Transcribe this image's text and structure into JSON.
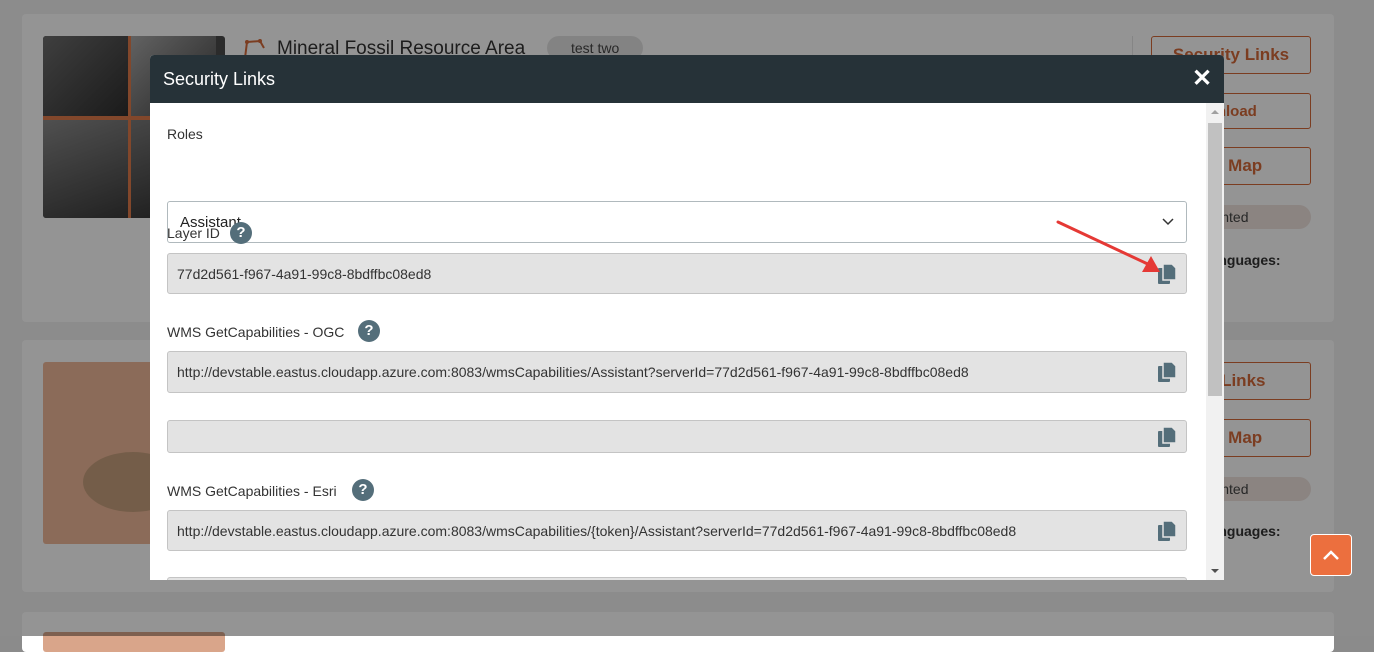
{
  "background": {
    "card1": {
      "title": "Mineral Fossil Resource Area",
      "tag": "test two",
      "buttons": [
        "Security Links",
        "wnload",
        "On Map"
      ],
      "status": "ented",
      "languages_label": "Languages:"
    },
    "card2": {
      "buttons": [
        "ity Links",
        "On Map"
      ],
      "status": "ented",
      "languages_label": "Languages:"
    }
  },
  "modal": {
    "title": "Security Links",
    "close_icon": "close-icon",
    "roles": {
      "label": "Roles",
      "selected": "Assistant"
    },
    "layer_id": {
      "label": "Layer ID",
      "value": "77d2d561-f967-4a91-99c8-8bdffbc08ed8"
    },
    "wms_ogc": {
      "label": "WMS GetCapabilities - OGC",
      "value": "http://devstable.eastus.cloudapp.azure.com:8083/wmsCapabilities/Assistant?serverId=77d2d561-f967-4a91-99c8-8bdffbc08ed8"
    },
    "empty_field": {
      "value": ""
    },
    "wms_esri": {
      "label": "WMS GetCapabilities - Esri",
      "value": "http://devstable.eastus.cloudapp.azure.com:8083/wmsCapabilities/{token}/Assistant?serverId=77d2d561-f967-4a91-99c8-8bdffbc08ed8"
    },
    "help_glyph": "?"
  },
  "colors": {
    "accent": "#d5693a",
    "header": "#263238",
    "arrow": "#e53935"
  }
}
